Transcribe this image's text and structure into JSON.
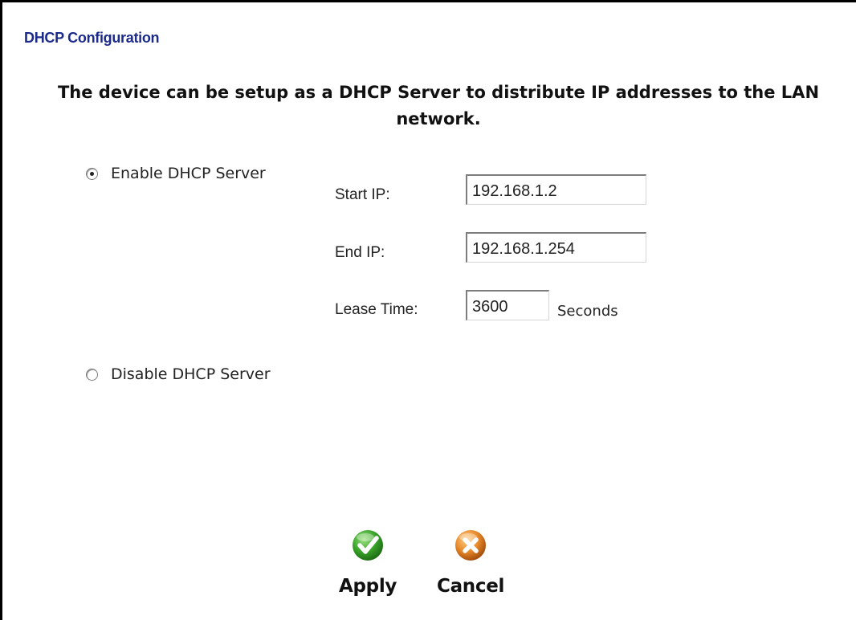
{
  "page": {
    "title": "DHCP Configuration",
    "description": "The device can be setup as a DHCP Server to distribute IP addresses to the LAN network."
  },
  "options": {
    "enable_label": "Enable DHCP Server",
    "disable_label": "Disable DHCP Server",
    "selected": "enable"
  },
  "fields": {
    "start_ip": {
      "label": "Start IP:",
      "value": "192.168.1.2"
    },
    "end_ip": {
      "label": "End IP:",
      "value": "192.168.1.254"
    },
    "lease_time": {
      "label": "Lease Time:",
      "value": "3600",
      "unit": "Seconds"
    }
  },
  "actions": {
    "apply_label": "Apply",
    "cancel_label": "Cancel"
  },
  "colors": {
    "title": "#1c2a8c",
    "apply_icon": "#3aa52a",
    "cancel_icon": "#e8892a"
  },
  "icons": {
    "apply": "checkmark-icon",
    "cancel": "x-icon"
  }
}
